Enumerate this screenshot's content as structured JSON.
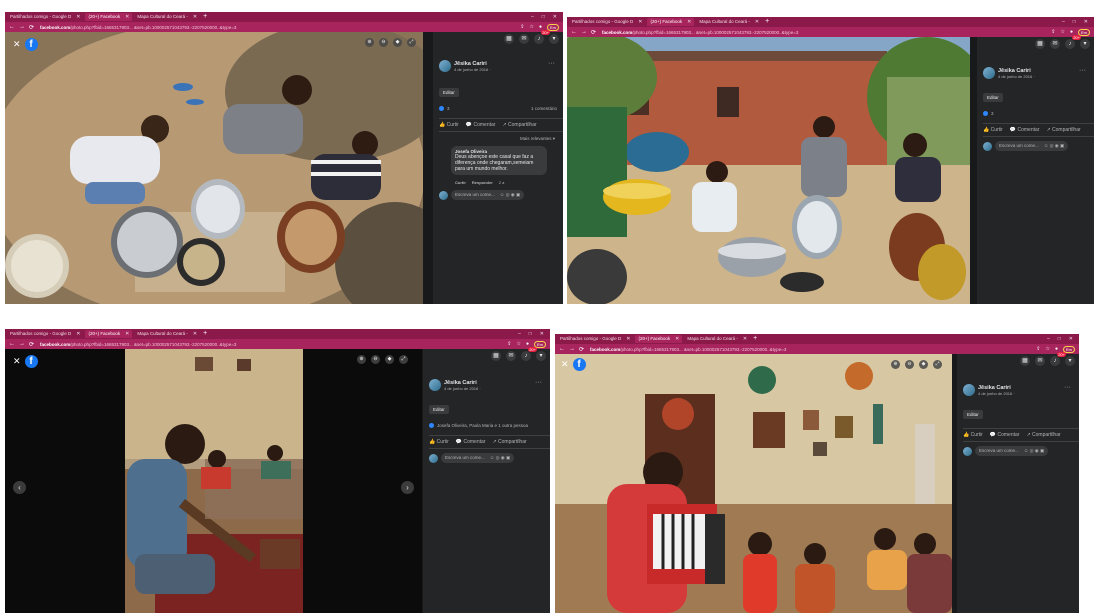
{
  "browser": {
    "tabs": [
      "Partilhados comigo - Google D",
      "(20+) Facebook",
      "Mapa Cultural do Ceará -"
    ],
    "new_tab": "+",
    "url_prefix": "facebook.com",
    "url_rest": "/photo.php?fbid=1665317903... &set=pb.100002571043793.-2207520000..&type=3",
    "url_rest_b": "/photo.php?fbid=1665317903... &set=pb.100002571043793.-2207520000..&type=3",
    "win_min": "–",
    "win_max": "□",
    "win_close": "✕",
    "profile_pill": "Em",
    "notif_count": "20+"
  },
  "post": {
    "author": "Jêsika Cariri",
    "date": "4 de junho de 2016 ·",
    "edit_label": "Editar",
    "more": "···",
    "like_action": "Curtir",
    "comment_action": "Comentar",
    "share_action": "Compartilhar",
    "write_placeholder": "Escreva um come...",
    "write_icons": "☺ ◎ ◉ ▣"
  },
  "shot1": {
    "react_count": "3",
    "comments_count": "1 comentário",
    "relevant_label": "Mais relevantes ▾",
    "comment_author": "Josefa Oliveira",
    "comment_text": "Deus abençoe este casal que faz a diferença onde chegaram,semeiam para um mundo melhor.",
    "comment_like": "Curtir",
    "comment_reply": "Responder",
    "comment_time": "2 a"
  },
  "shot2": {
    "react_count": "3"
  },
  "shot3": {
    "reactors": "Josefa Oliveira, Paula Maria e 1 outra pessoa"
  },
  "photos": {
    "caption1": "children drumming",
    "caption2": "children drumming outdoors",
    "caption3": "boy with guitar",
    "caption4": "girl with accordion"
  }
}
